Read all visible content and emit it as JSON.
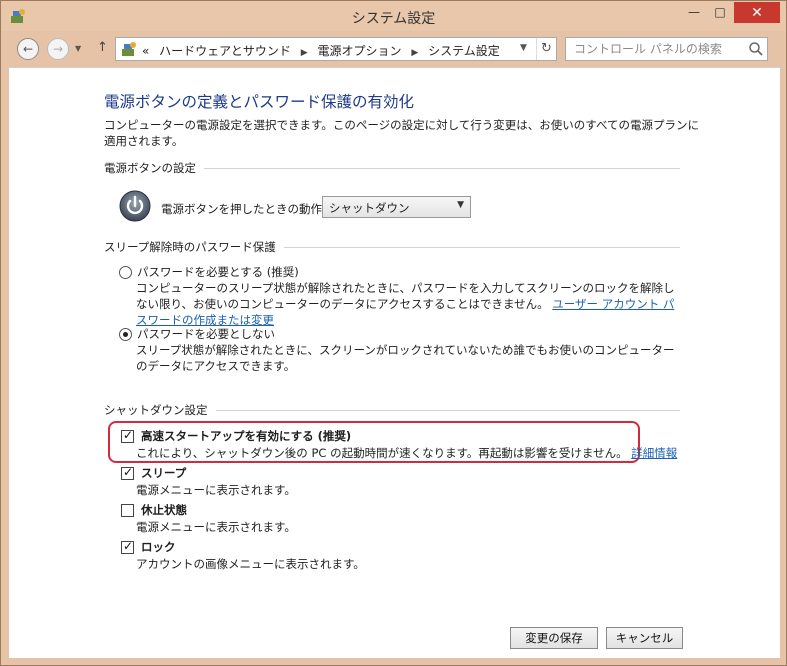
{
  "window": {
    "title": "システム設定",
    "minimize_glyph": "—",
    "maximize_glyph": "□",
    "close_glyph": "✕"
  },
  "nav": {
    "back_glyph": "←",
    "forward_glyph": "→",
    "recent_glyph": "▼",
    "up_glyph": "↑",
    "breadcrumb_prefix": "«",
    "breadcrumbs": [
      "ハードウェアとサウンド",
      "電源オプション",
      "システム設定"
    ],
    "crumb_separator": "▶",
    "dropdown_glyph": "▼",
    "refresh_glyph": "↻",
    "search_placeholder": "コントロール パネルの検索"
  },
  "page": {
    "title": "電源ボタンの定義とパスワード保護の有効化",
    "description": "コンピューターの電源設定を選択できます。このページの設定に対して行う変更は、お使いのすべての電源プランに適用されます。"
  },
  "power_button": {
    "section_title": "電源ボタンの設定",
    "action_label": "電源ボタンを押したときの動作:",
    "selected_action": "シャットダウン",
    "select_arrow": "▼"
  },
  "wake_password": {
    "section_title": "スリープ解除時のパスワード保護",
    "options": [
      {
        "label": "パスワードを必要とする (推奨)",
        "selected": false,
        "description": "コンピューターのスリープ状態が解除されたときに、パスワードを入力してスクリーンのロックを解除しない限り、お使いのコンピューターのデータにアクセスすることはできません。",
        "link_text": "ユーザー アカウント パスワードの作成または変更"
      },
      {
        "label": "パスワードを必要としない",
        "selected": true,
        "description": "スリープ状態が解除されたときに、スクリーンがロックされていないため誰でもお使いのコンピューターのデータにアクセスできます。"
      }
    ]
  },
  "shutdown": {
    "section_title": "シャットダウン設定",
    "items": [
      {
        "label": "高速スタートアップを有効にする (推奨)",
        "checked": true,
        "description": "これにより、シャットダウン後の PC の起動時間が速くなります。再起動は影響を受けません。",
        "link_text": "詳細情報"
      },
      {
        "label": "スリープ",
        "checked": true,
        "description": "電源メニューに表示されます。"
      },
      {
        "label": "休止状態",
        "checked": false,
        "description": "電源メニューに表示されます。"
      },
      {
        "label": "ロック",
        "checked": true,
        "description": "アカウントの画像メニューに表示されます。"
      }
    ]
  },
  "footer": {
    "save_label": "変更の保存",
    "cancel_label": "キャンセル"
  },
  "colors": {
    "title_blue": "#1e3a8a",
    "link_blue": "#1a5fb4",
    "highlight_red": "#d42a3c",
    "chrome": "#e6c3a6",
    "close_red": "#c7392e"
  }
}
